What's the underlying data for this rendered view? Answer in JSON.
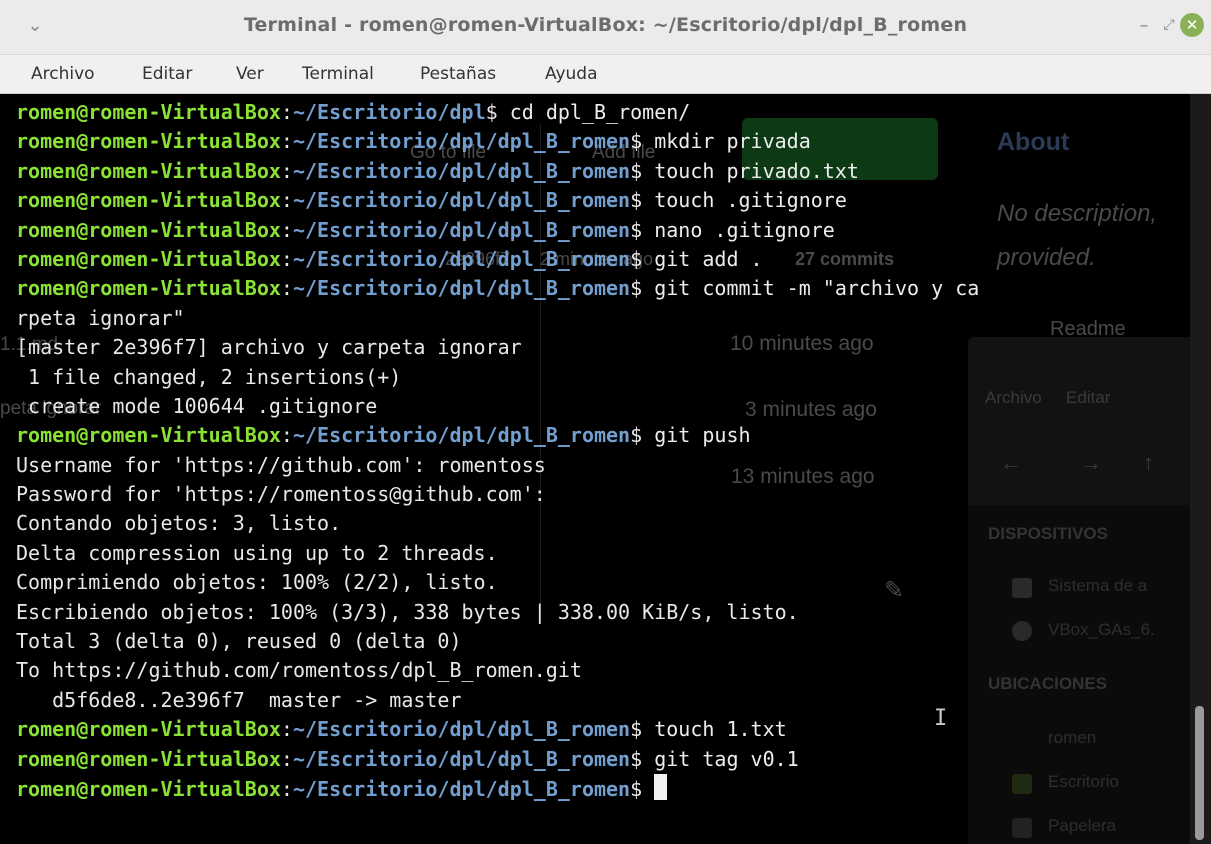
{
  "window": {
    "title": "Terminal - romen@romen-VirtualBox: ~/Escritorio/dpl/dpl_B_romen",
    "menu_glyph": "⌄",
    "min_glyph": "–",
    "max_glyph": "⤢",
    "close_glyph": "✕"
  },
  "menubar": {
    "items": [
      "Archivo",
      "Editar",
      "Ver",
      "Terminal",
      "Pestañas",
      "Ayuda"
    ]
  },
  "colors": {
    "prompt_user": "#8ae234",
    "prompt_path": "#729fcf",
    "background": "#000000",
    "close_button": "#8bb158"
  },
  "terminal": {
    "lines": [
      {
        "kind": "prompt",
        "user": "romen@romen-VirtualBox",
        "path": "~/Escritorio/dpl",
        "cmd": " cd dpl_B_romen/"
      },
      {
        "kind": "prompt",
        "user": "romen@romen-VirtualBox",
        "path": "~/Escritorio/dpl/dpl_B_romen",
        "cmd": " mkdir privada"
      },
      {
        "kind": "prompt",
        "user": "romen@romen-VirtualBox",
        "path": "~/Escritorio/dpl/dpl_B_romen",
        "cmd": " touch privado.txt"
      },
      {
        "kind": "prompt",
        "user": "romen@romen-VirtualBox",
        "path": "~/Escritorio/dpl/dpl_B_romen",
        "cmd": " touch .gitignore"
      },
      {
        "kind": "prompt",
        "user": "romen@romen-VirtualBox",
        "path": "~/Escritorio/dpl/dpl_B_romen",
        "cmd": " nano .gitignore"
      },
      {
        "kind": "prompt",
        "user": "romen@romen-VirtualBox",
        "path": "~/Escritorio/dpl/dpl_B_romen",
        "cmd": " git add ."
      },
      {
        "kind": "prompt",
        "user": "romen@romen-VirtualBox",
        "path": "~/Escritorio/dpl/dpl_B_romen",
        "cmd": " git commit -m \"archivo y ca"
      },
      {
        "kind": "output",
        "text": "rpeta ignorar\""
      },
      {
        "kind": "output",
        "text": "[master 2e396f7] archivo y carpeta ignorar"
      },
      {
        "kind": "output",
        "text": " 1 file changed, 2 insertions(+)"
      },
      {
        "kind": "output",
        "text": " create mode 100644 .gitignore"
      },
      {
        "kind": "prompt",
        "user": "romen@romen-VirtualBox",
        "path": "~/Escritorio/dpl/dpl_B_romen",
        "cmd": " git push"
      },
      {
        "kind": "output",
        "text": "Username for 'https://github.com': romentoss"
      },
      {
        "kind": "output",
        "text": "Password for 'https://romentoss@github.com':"
      },
      {
        "kind": "output",
        "text": "Contando objetos: 3, listo."
      },
      {
        "kind": "output",
        "text": "Delta compression using up to 2 threads."
      },
      {
        "kind": "output",
        "text": "Comprimiendo objetos: 100% (2/2), listo."
      },
      {
        "kind": "output",
        "text": "Escribiendo objetos: 100% (3/3), 338 bytes | 338.00 KiB/s, listo."
      },
      {
        "kind": "output",
        "text": "Total 3 (delta 0), reused 0 (delta 0)"
      },
      {
        "kind": "output",
        "text": "To https://github.com/romentoss/dpl_B_romen.git"
      },
      {
        "kind": "output",
        "text": "   d5f6de8..2e396f7  master -> master"
      },
      {
        "kind": "prompt",
        "user": "romen@romen-VirtualBox",
        "path": "~/Escritorio/dpl/dpl_B_romen",
        "cmd": " touch 1.txt"
      },
      {
        "kind": "prompt",
        "user": "romen@romen-VirtualBox",
        "path": "~/Escritorio/dpl/dpl_B_romen",
        "cmd": " git tag v0.1"
      },
      {
        "kind": "prompt_active",
        "user": "romen@romen-VirtualBox",
        "path": "~/Escritorio/dpl/dpl_B_romen",
        "cmd": " "
      }
    ]
  },
  "background_ghost": {
    "about_title": "About",
    "about_desc_1": "No description,",
    "about_desc_2": "provided.",
    "readme": "Readme",
    "go_to_file": "Go to file",
    "add_file": "Add file",
    "commit_hash": "2e396f7",
    "time_2": "2 minutes ago",
    "commits": "27 commits",
    "file_1": "1.1.md",
    "time_10": "10 minutes ago",
    "file_2": "peta ignorar",
    "time_3": "3 minutes ago",
    "time_13": "13 minutes ago",
    "fm_menu_1": "Archivo",
    "fm_menu_2": "Editar",
    "fm_devices": "DISPOSITIVOS",
    "fm_dev_1": "Sistema de a",
    "fm_dev_2": "VBox_GAs_6.",
    "fm_places": "UBICACIONES",
    "fm_place_1": "romen",
    "fm_place_2": "Escritorio",
    "fm_place_3": "Papelera"
  }
}
